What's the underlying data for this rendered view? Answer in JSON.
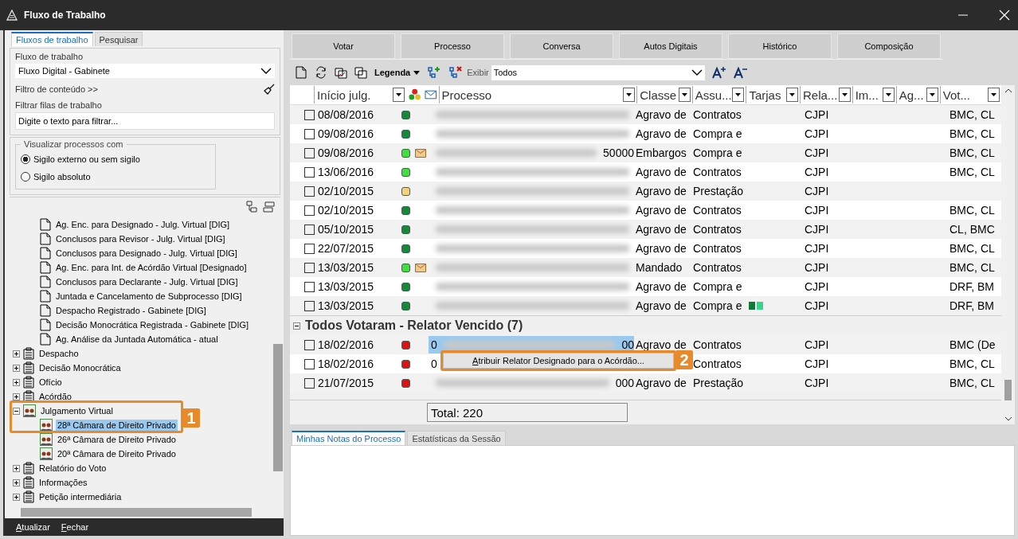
{
  "window": {
    "title": "Fluxo de Trabalho"
  },
  "left_tabs": [
    {
      "label": "Fluxos de trabalho",
      "selected": true
    },
    {
      "label": "Pesquisar",
      "selected": false
    }
  ],
  "workflow": {
    "label": "Fluxo de trabalho",
    "value": "Fluxo Digital - Gabinete"
  },
  "content_filter": {
    "label": "Filtro de conteúdo >>"
  },
  "queue_filter": {
    "label": "Filtrar filas de trabalho",
    "placeholder": "Digite o texto para filtrar..."
  },
  "visibility": {
    "legend": "Visualizar processos com",
    "options": [
      {
        "label": "Sigilo externo ou sem sigilo",
        "selected": true
      },
      {
        "label": "Sigilo absoluto",
        "selected": false
      }
    ]
  },
  "tree": [
    {
      "kind": "hidden",
      "children": [
        {
          "kind": "queue",
          "label": "Ag. Enc. para Designado - Julg. Virtual [DIG]",
          "selected": false
        },
        {
          "kind": "queue",
          "label": "Conclusos para Revisor - Julg. Virtual [DIG]",
          "selected": false
        },
        {
          "kind": "queue",
          "label": "Conclusos para Designado - Julg. Virtual [DIG]",
          "selected": false
        },
        {
          "kind": "queue",
          "label": "Ag. Enc. para Int. de Acórdão Virtual [Designado]",
          "selected": false
        },
        {
          "kind": "queue",
          "label": "Conclusos para Declarante - Julg. Virtual [DIG]",
          "selected": false
        },
        {
          "kind": "queue",
          "label": "Juntada e Cancelamento de Subprocesso [DIG]",
          "selected": false
        },
        {
          "kind": "queue",
          "label": "Despacho Registrado - Gabinete [DIG]",
          "selected": false
        },
        {
          "kind": "queue",
          "label": "Decisão Monocrática Registrada - Gabinete [DIG]",
          "selected": false
        },
        {
          "kind": "queue",
          "label": "Ag. Análise da Juntada Automática - atual",
          "selected": false
        }
      ]
    },
    {
      "kind": "folder",
      "label": "Despacho",
      "expanded": false,
      "selected": false
    },
    {
      "kind": "folder",
      "label": "Decisão Monocrática",
      "expanded": false,
      "selected": false
    },
    {
      "kind": "folder",
      "label": "Ofício",
      "expanded": false,
      "selected": false
    },
    {
      "kind": "folder",
      "label": "Acórdão",
      "expanded": false,
      "selected": false
    },
    {
      "kind": "group",
      "label": "Julgamento Virtual",
      "expanded": true,
      "selected": false,
      "children": [
        {
          "kind": "group",
          "label": "28ª Câmara de Direito Privado",
          "selected": true
        },
        {
          "kind": "group",
          "label": "26ª Câmara de Direito Privado",
          "selected": false
        },
        {
          "kind": "group",
          "label": "20ª Câmara de Direito Privado",
          "selected": false
        }
      ]
    },
    {
      "kind": "folder",
      "label": "Relatório do Voto",
      "expanded": false,
      "selected": false
    },
    {
      "kind": "folder",
      "label": "Informações",
      "expanded": false,
      "selected": false
    },
    {
      "kind": "folder",
      "label": "Petição intermediária",
      "expanded": false,
      "selected": false
    }
  ],
  "left_footer": [
    "Atualizar",
    "Fechar"
  ],
  "action_buttons": [
    "Votar",
    "Processo",
    "Conversa",
    "Autos Digitais",
    "Histórico",
    "Composição"
  ],
  "toolbar": {
    "legend_label": "Legenda",
    "show_label": "Exibir",
    "show_value": "Todos"
  },
  "table": {
    "columns": [
      "Início julg.",
      "Processo",
      "Classe",
      "Assu...",
      "Tarjas",
      "Rela...",
      "Im...",
      "Ag...",
      "Vot..."
    ],
    "sections": [
      {
        "rows": [
          {
            "checked": false,
            "selected": false,
            "date": "08/08/2016",
            "color": "#138a3a",
            "mail": false,
            "classe": "Agravo de",
            "assunto": "Contratos",
            "tags": [],
            "relator": "CJPI",
            "votos": "BMC, CL"
          },
          {
            "checked": false,
            "selected": false,
            "date": "09/08/2016",
            "color": "#138a3a",
            "mail": false,
            "classe": "Agravo de",
            "assunto": "Compra e",
            "tags": [],
            "relator": "CJPI",
            "votos": "BMC, CL"
          },
          {
            "checked": false,
            "selected": false,
            "date": "09/08/2016",
            "color": "#3ee03e",
            "mail": true,
            "process_end": "50000",
            "classe": "Embargos",
            "assunto": "Compra e",
            "tags": [],
            "relator": "CJPI",
            "votos": "BMC, CL"
          },
          {
            "checked": false,
            "selected": false,
            "date": "13/06/2016",
            "color": "#3ee03e",
            "mail": false,
            "classe": "Agravo de",
            "assunto": "Contratos",
            "tags": [],
            "relator": "CJPI",
            "votos": "BMC, CL"
          },
          {
            "checked": false,
            "selected": false,
            "date": "02/10/2015",
            "color": "#f2d27a",
            "mail": false,
            "classe": "Agravo de",
            "assunto": "Prestação",
            "tags": [],
            "relator": "CJPI"
          },
          {
            "checked": false,
            "selected": false,
            "date": "02/10/2015",
            "color": "#138a3a",
            "mail": false,
            "classe": "Agravo de",
            "assunto": "Contratos",
            "tags": [],
            "relator": "CJPI",
            "votos": "BMC, CL"
          },
          {
            "checked": false,
            "selected": false,
            "date": "05/10/2015",
            "color": "#138a3a",
            "mail": false,
            "classe": "Agravo de",
            "assunto": "Contratos",
            "tags": [],
            "relator": "CJPI",
            "votos": "CL, BMC"
          },
          {
            "checked": false,
            "selected": false,
            "date": "22/07/2015",
            "color": "#138a3a",
            "mail": false,
            "classe": "Agravo de",
            "assunto": "Contratos",
            "tags": [],
            "relator": "CJPI",
            "votos": "BMC, CL"
          },
          {
            "checked": false,
            "selected": false,
            "date": "13/03/2015",
            "color": "#3ee03e",
            "mail": true,
            "classe": "Mandado",
            "assunto": "Contratos",
            "tags": [],
            "relator": "CJPI",
            "votos": "BMC, CL"
          },
          {
            "checked": false,
            "selected": false,
            "date": "13/03/2015",
            "color": "#138a3a",
            "mail": false,
            "classe": "Agravo de",
            "assunto": "Compra e",
            "tags": [],
            "relator": "CJPI",
            "votos": "DRF, BM"
          },
          {
            "checked": false,
            "selected": false,
            "date": "13/03/2015",
            "color": "#138a3a",
            "mail": false,
            "classe": "Agravo de",
            "assunto": "Compra e",
            "tags": [
              {
                "color": "#0f7a3a"
              },
              {
                "color": "#3ad38e"
              }
            ],
            "relator": "CJPI",
            "votos": "DRF, BM"
          }
        ]
      },
      {
        "title": "Todos Votaram - Relator Vencido (7)",
        "expanded": true,
        "rows": [
          {
            "checked": false,
            "selected": true,
            "date": "18/02/2016",
            "color": "#e01010",
            "mail": false,
            "process_start": "0",
            "process_end": "00",
            "classe": "Agravo de",
            "assunto": "Contratos",
            "tags": [],
            "relator": "CJPI",
            "votos": "BMC (De"
          },
          {
            "checked": false,
            "selected": false,
            "date": "18/02/2016",
            "color": "#e01010",
            "mail": false,
            "process_start": "0",
            "assunto": "Contratos",
            "tags": [],
            "relator": "CJPI",
            "votos": "BMC, CL"
          },
          {
            "checked": false,
            "selected": false,
            "date": "21/07/2015",
            "color": "#e01010",
            "mail": false,
            "process_end": "000",
            "classe": "Agravo de",
            "assunto": "Prestação",
            "tags": [],
            "relator": "CJPI",
            "votos": "BMC, CL"
          }
        ]
      }
    ]
  },
  "total": "Total: 220",
  "notes_tabs": [
    {
      "label": "Minhas Notas do Processo",
      "selected": true
    },
    {
      "label": "Estatísticas da Sessão",
      "selected": false
    }
  ],
  "context_menu": {
    "item": "Atribuir Relator Designado para o Acórdão..."
  },
  "callouts": [
    "1",
    "2"
  ]
}
